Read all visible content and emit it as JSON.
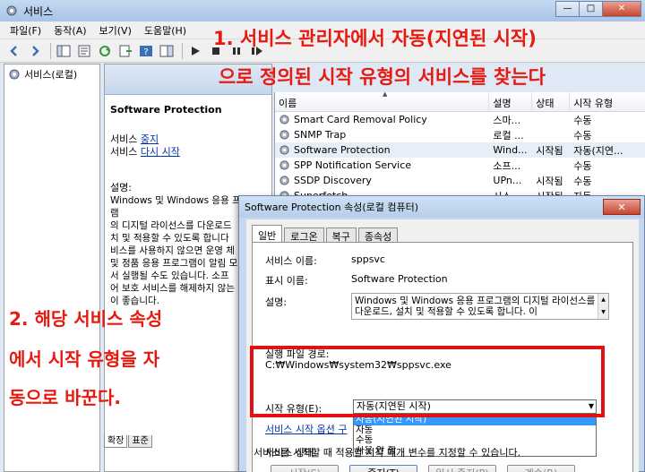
{
  "window": {
    "title": "서비스"
  },
  "menu": [
    "파일(F)",
    "동작(A)",
    "보기(V)",
    "도움말(H)"
  ],
  "tree": {
    "item": "서비스(로컬)"
  },
  "description": {
    "title": "Software Protection",
    "line1_prefix": "서비스 ",
    "line1_link": "중지",
    "line2_prefix": "서비스 ",
    "line2_link": "다시 시작",
    "body_label": "설명:",
    "body": "Windows 및 Windows 응용 프로그램\n의 디지털 라이선스를 다운로드\n치 및 적용할 수 있도록 합니다\n비스를 사용하지 않으면 운영 체\n및 정품 응용 프로그램이 알림 모\n서 실행될 수도 있습니다. 소프\n어 보호 서비스를 해제하지 않는\n이 좋습니다."
  },
  "bottom_tabs": [
    "확장",
    "표준"
  ],
  "list": {
    "headers": {
      "name": "이름",
      "desc": "설명",
      "status": "상태",
      "start": "시작 유형"
    },
    "rows": [
      {
        "name": "Smart Card Removal Policy",
        "desc": "스마...",
        "status": "",
        "start": "수동"
      },
      {
        "name": "SNMP Trap",
        "desc": "로컬 ...",
        "status": "",
        "start": "수동"
      },
      {
        "name": "Software Protection",
        "desc": "Wind...",
        "status": "시작됨",
        "start": "자동(지연..."
      },
      {
        "name": "SPP Notification Service",
        "desc": "소프...",
        "status": "",
        "start": "수동"
      },
      {
        "name": "SSDP Discovery",
        "desc": "UPn...",
        "status": "시작됨",
        "start": "수동"
      },
      {
        "name": "Superfetch",
        "desc": "시스...",
        "status": "시작됨",
        "start": "자동"
      }
    ]
  },
  "annotations": {
    "step1_line1": "1.  서비스 관리자에서 자동(지연된 시작)",
    "step1_line2": "으로 정의된 시작 유형의 서비스를 찾는다",
    "step2_line1": "2.  해당 서비스 속성",
    "step2_line2": "에서 시작 유형을 자",
    "step2_line3": "동으로 바꾼다."
  },
  "dialog": {
    "title": "Software Protection 속성(로컬 컴퓨터)",
    "tabs": [
      "일반",
      "로그온",
      "복구",
      "종속성"
    ],
    "service_name_label": "서비스 이름:",
    "service_name": "sppsvc",
    "display_name_label": "표시 이름:",
    "display_name": "Software Protection",
    "desc_label": "설명:",
    "desc_text": "Windows 및 Windows 응용 프로그램의 디지털 라이선스를 다운로드, 설치 및 적용할 수 있도록 합니다. 이",
    "exe_path_label": "실행 파일 경로:",
    "exe_path": "C:₩Windows₩system32₩sppsvc.exe",
    "start_type_label": "시작 유형(E):",
    "start_type_selected": "자동(지연된 시작)",
    "start_type_options": [
      "자동(지연된 시작)",
      "자동",
      "수동",
      "사용 안 함"
    ],
    "service_options_link": "서비스 시작 옵션 구",
    "service_status_label": "서비스 상태:",
    "buttons": {
      "start": "시작(S)",
      "stop": "중지(T)",
      "pause": "일시 중지(P)",
      "resume": "계속(R)"
    },
    "bottom_note": "서비스를 시작할 때 적용할 시작 매개 변수를 지정할 수 있습니다."
  }
}
